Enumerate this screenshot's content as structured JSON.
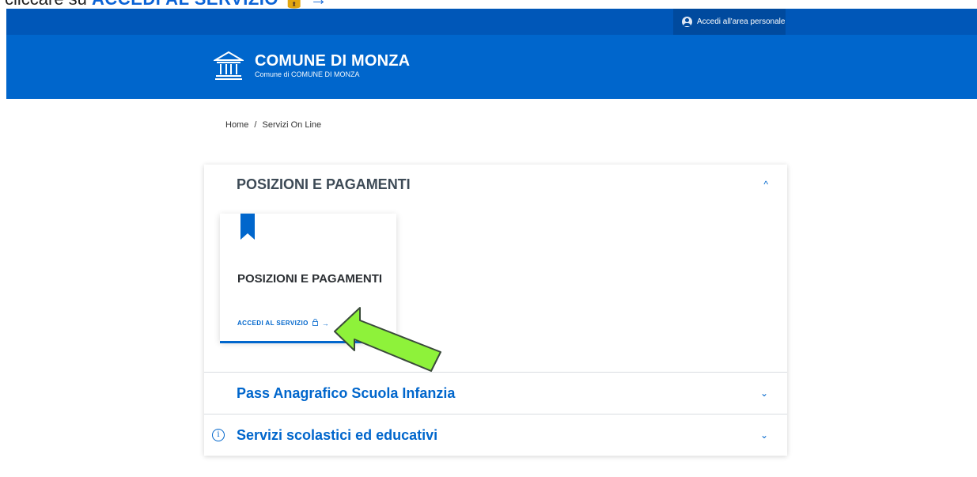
{
  "instruction": {
    "prefix": "cliccare su ",
    "highlight": "ACCEDI AL SERVIZIO",
    "lock_glyph": "🔒",
    "arrow_glyph": "→"
  },
  "topbar": {
    "login_label": "Accedi all'area personale",
    "login_icon": "user-icon",
    "bg_color": "#0057b8"
  },
  "header": {
    "title": "COMUNE DI MONZA",
    "subtitle": "Comune di COMUNE DI MONZA",
    "logo_icon": "municipality-building-icon",
    "bg_color": "#0066cc"
  },
  "breadcrumb": {
    "items": [
      "Home",
      "Servizi On Line"
    ],
    "separator": "/"
  },
  "accordion": [
    {
      "title": "POSIZIONI E PAGAMENTI",
      "expanded": true,
      "chevron": "^",
      "cards": [
        {
          "title": "POSIZIONI E PAGAMENTI",
          "icon": "bookmark-icon",
          "action_label": "ACCEDI AL SERVIZIO",
          "lock_glyph": "🔒",
          "arrow_glyph": "→"
        }
      ]
    },
    {
      "title": "Pass Anagrafico Scuola Infanzia",
      "expanded": false,
      "chevron": "⌄"
    },
    {
      "title": "Servizi scolastici ed educativi",
      "expanded": false,
      "chevron": "⌄",
      "info_glyph": "i"
    }
  ],
  "colors": {
    "primary": "#0066cc",
    "annotation_arrow": "#8ef23a"
  }
}
